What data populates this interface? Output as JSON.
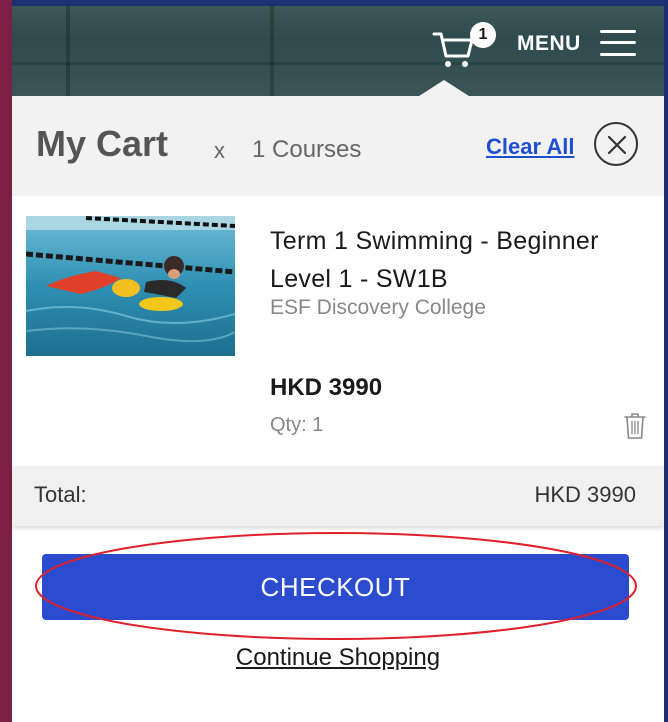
{
  "header": {
    "cart_count": "1",
    "menu_label": "MENU"
  },
  "cart": {
    "title": "My Cart",
    "multiplier": "x",
    "count_text": "1 Courses",
    "clear_all": "Clear All"
  },
  "item": {
    "title": "Term 1 Swimming - Beginner Level 1 - SW1B",
    "school": "ESF Discovery College",
    "price": "HKD 3990",
    "qty": "Qty: 1"
  },
  "total": {
    "label": "Total:",
    "value": "HKD 3990"
  },
  "actions": {
    "checkout": "CHECKOUT",
    "continue": "Continue Shopping"
  },
  "colors": {
    "accent": "#2b4ccf",
    "link": "#1f4fd1",
    "annotation": "#e0202a"
  },
  "icons": [
    "cart-icon",
    "hamburger-menu-icon",
    "close-icon",
    "trash-icon"
  ]
}
